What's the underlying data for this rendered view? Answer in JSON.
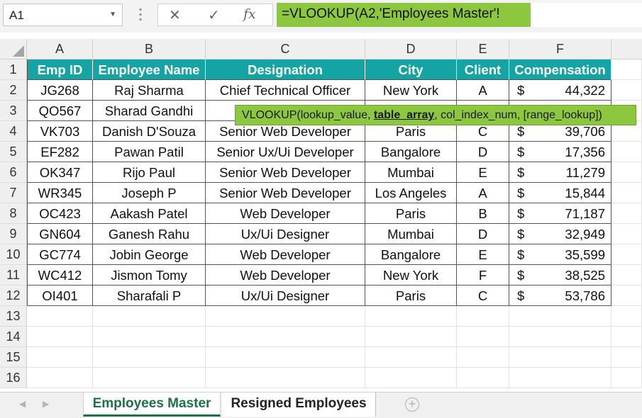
{
  "formula_bar": {
    "name_box": "A1",
    "formula": "=VLOOKUP(A2,'Employees Master'!",
    "cancel_icon": "✕",
    "enter_icon": "✓",
    "fx_label": "fx"
  },
  "columns": [
    "A",
    "B",
    "C",
    "D",
    "E",
    "F"
  ],
  "rows": [
    "1",
    "2",
    "3",
    "4",
    "5",
    "6",
    "7",
    "8",
    "9",
    "10",
    "11",
    "12",
    "13",
    "14",
    "15",
    "16"
  ],
  "table": {
    "headers": [
      "Emp ID",
      "Employee Name",
      "Designation",
      "City",
      "Client",
      "Compensation"
    ],
    "currency": "$",
    "records": [
      [
        "JG268",
        "Raj Sharma",
        "Chief Technical Officer",
        "New York",
        "A",
        "44,322"
      ],
      [
        "QO567",
        "Sharad Gandhi",
        "",
        "",
        "",
        ""
      ],
      [
        "VK703",
        "Danish D'Souza",
        "Senior Web Developer",
        "Paris",
        "C",
        "39,706"
      ],
      [
        "EF282",
        "Pawan Patil",
        "Senior Ux/Ui Developer",
        "Bangalore",
        "D",
        "17,356"
      ],
      [
        "OK347",
        "Rijo Paul",
        "Senior Web Developer",
        "Mumbai",
        "E",
        "11,279"
      ],
      [
        "WR345",
        "Joseph P",
        "Senior Web Developer",
        "Los Angeles",
        "A",
        "15,844"
      ],
      [
        "OC423",
        "Aakash Patel",
        "Web Developer",
        "Paris",
        "B",
        "71,187"
      ],
      [
        "GN604",
        "Ganesh Rahu",
        "Ux/Ui Designer",
        "Mumbai",
        "D",
        "32,949"
      ],
      [
        "GC774",
        "Jobin George",
        "Web Developer",
        "Bangalore",
        "E",
        "35,599"
      ],
      [
        "WC412",
        "Jismon Tomy",
        "Web Developer",
        "New York",
        "F",
        "38,525"
      ],
      [
        "OI401",
        "Sharafali P",
        "Ux/Ui Designer",
        "Paris",
        "C",
        "53,786"
      ]
    ]
  },
  "tooltip": {
    "pre": "VLOOKUP(lookup_value, ",
    "bold": "table_array",
    "post": ", col_index_num, [range_lookup])"
  },
  "sheet_tabs": {
    "active": "Employees Master",
    "other": "Resigned Employees",
    "add_icon": "+"
  },
  "colors": {
    "header_bg": "#14a4a4",
    "formula_bg": "#8dc63f",
    "tab_active": "#1e7145"
  }
}
